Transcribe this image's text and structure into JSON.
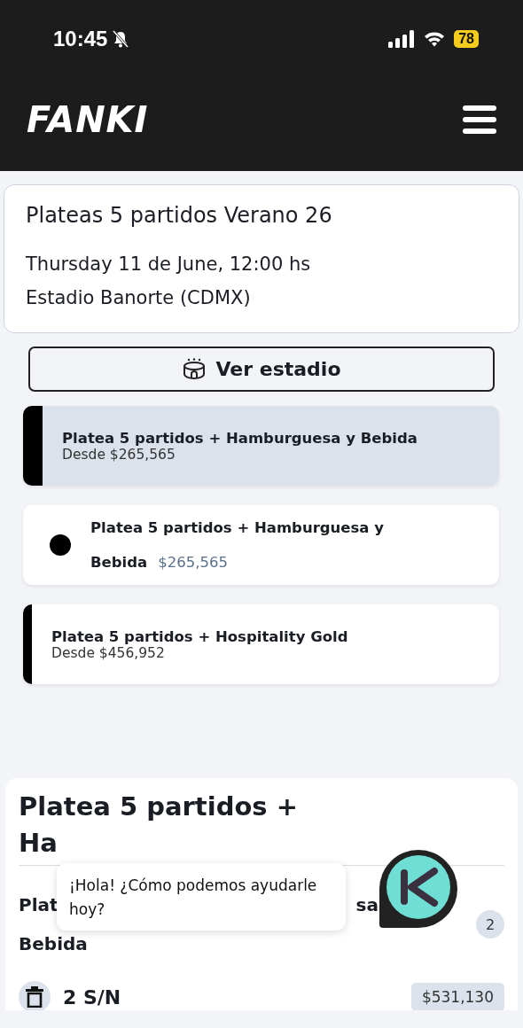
{
  "status_bar": {
    "time": "10:45",
    "silent": true,
    "battery": "78"
  },
  "header": {
    "logo": "FANKI"
  },
  "event": {
    "title": "Plateas 5 partidos Verano 26",
    "date": "Thursday 11 de June, 12:00 hs",
    "venue": "Estadio Banorte (CDMX)"
  },
  "stadium_button": {
    "label": "Ver estadio"
  },
  "options": [
    {
      "kind": "bar",
      "selected": true,
      "name": "Platea 5 partidos + Hamburguesa y Bebida",
      "price": "Desde $265,565"
    },
    {
      "kind": "dot",
      "selected": false,
      "name": "Platea 5 partidos + Hamburguesa y Bebida",
      "price": "$265,565"
    },
    {
      "kind": "bar",
      "selected": false,
      "name": "Platea 5 partidos + Hospitality Gold",
      "price": "Desde $456,952"
    }
  ],
  "summary": {
    "title": "Platea 5 partidos + Ha",
    "item_start": "Plat",
    "item_middle": "sa",
    "item_end": "Bebida",
    "count": "2",
    "seat": "2 S/N",
    "total": "$531,130"
  },
  "chat": {
    "greeting": "¡Hola! ¿Cómo podemos ayudarle hoy?"
  }
}
